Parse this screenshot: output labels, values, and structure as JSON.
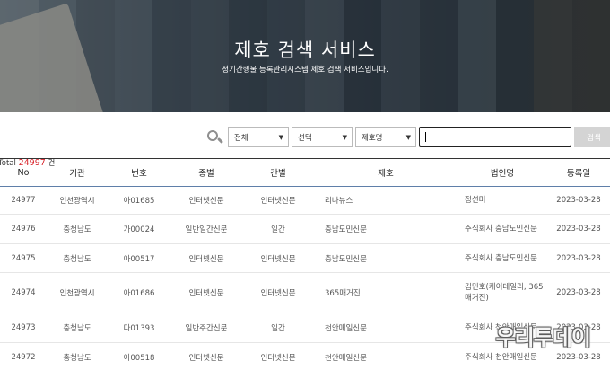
{
  "hero": {
    "title": "제호 검색 서비스",
    "subtitle": "정기간행물 등록관리시스템 제호 검색 서비스입니다."
  },
  "search": {
    "icon": "search-icon",
    "select_type": "전체",
    "select_choice": "선택",
    "select_field": "제호명",
    "input_value": "",
    "button_label": "검색"
  },
  "total": {
    "prefix": "Total",
    "count": "24997",
    "suffix": "건"
  },
  "table": {
    "headers": [
      "No",
      "기관",
      "번호",
      "종별",
      "간별",
      "제호",
      "법인명",
      "등록일"
    ],
    "rows": [
      {
        "no": "24977",
        "agency": "인천광역시",
        "number": "아01685",
        "type": "인터넷신문",
        "period": "인터넷신문",
        "title": "리나뉴스",
        "corp": "정선미",
        "date": "2023-03-28"
      },
      {
        "no": "24976",
        "agency": "충청남도",
        "number": "가00024",
        "type": "일반일간신문",
        "period": "일간",
        "title": "충남도민신문",
        "corp": "주식회사 충남도민신문",
        "date": "2023-03-28"
      },
      {
        "no": "24975",
        "agency": "충청남도",
        "number": "아00517",
        "type": "인터넷신문",
        "period": "인터넷신문",
        "title": "충남도민신문",
        "corp": "주식회사 충남도민신문",
        "date": "2023-03-28"
      },
      {
        "no": "24974",
        "agency": "인천광역시",
        "number": "아01686",
        "type": "인터넷신문",
        "period": "인터넷신문",
        "title": "365매거진",
        "corp": "김민호(케이데일리, 365매거진)",
        "date": "2023-03-28"
      },
      {
        "no": "24973",
        "agency": "충청남도",
        "number": "다01393",
        "type": "일반주간신문",
        "period": "일간",
        "title": "천안매일신문",
        "corp": "주식회사 천안매일신문",
        "date": "2023-03-28"
      },
      {
        "no": "24972",
        "agency": "충청남도",
        "number": "아00518",
        "type": "인터넷신문",
        "period": "인터넷신문",
        "title": "천안매일신문",
        "corp": "주식회사 천안매일신문",
        "date": "2023-03-28"
      }
    ]
  },
  "watermark": "우리투데이"
}
